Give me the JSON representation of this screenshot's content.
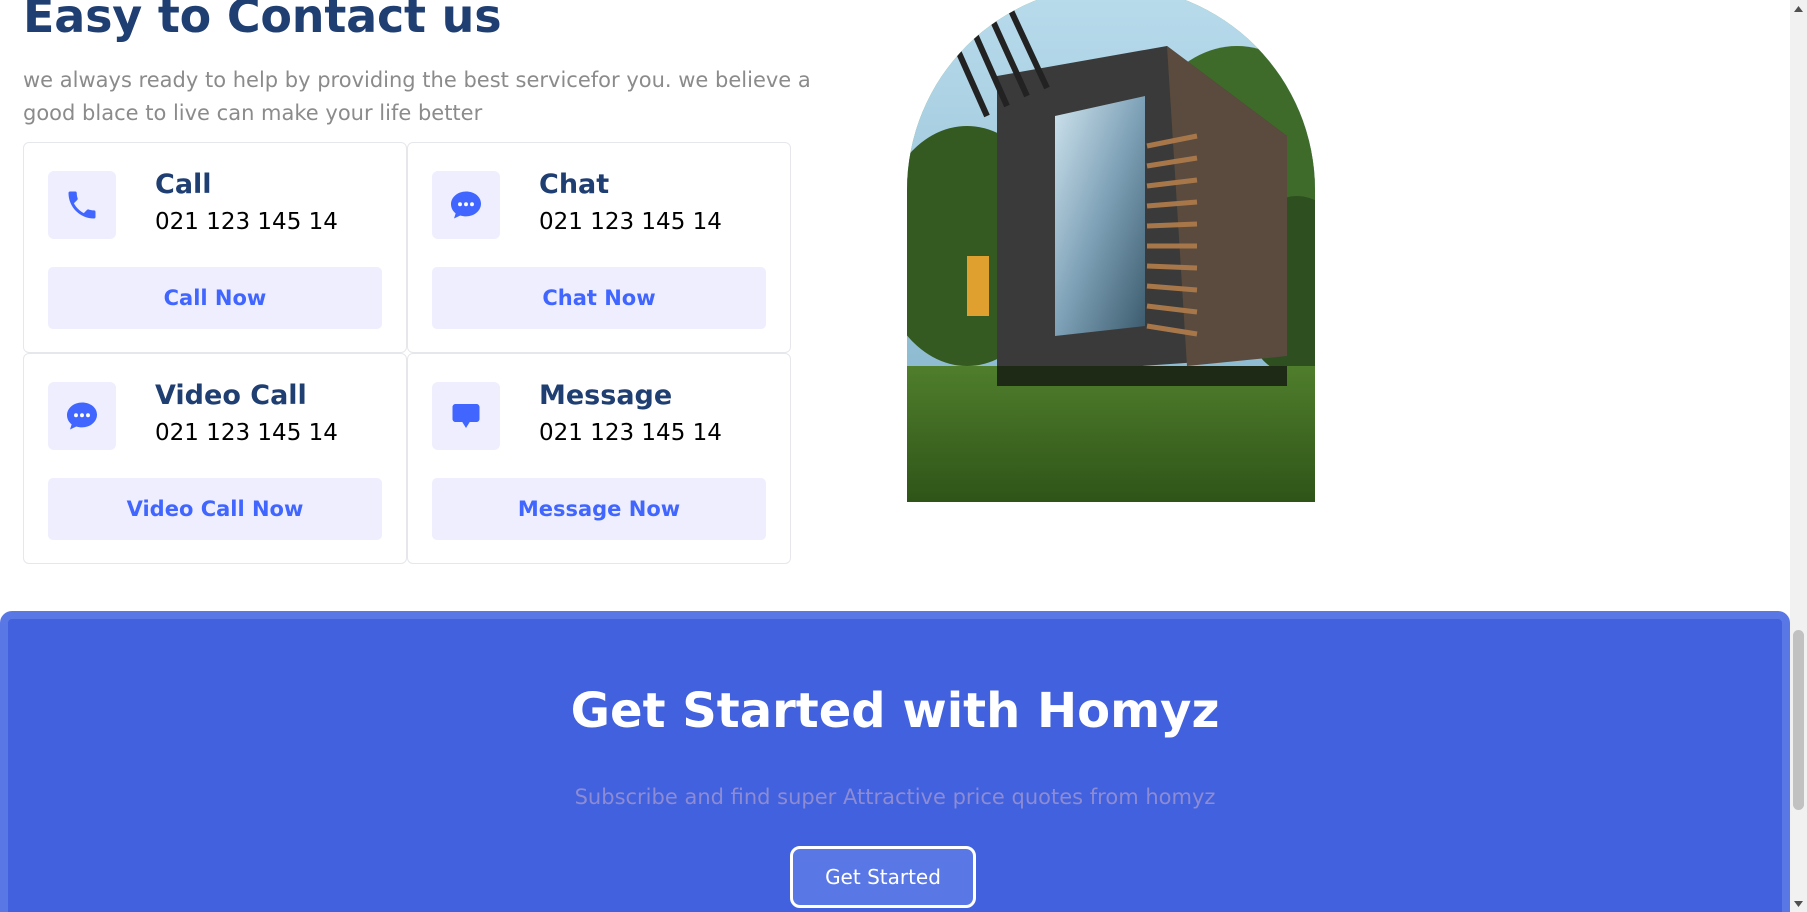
{
  "contact": {
    "title": "Easy to Contact us",
    "description": "we always ready to help by providing the best servicefor you. we believe a good blace to live can make your life better",
    "cards": [
      {
        "name": "Call",
        "phone": "021 123 145 14",
        "button": "Call Now",
        "icon": "phone-icon"
      },
      {
        "name": "Chat",
        "phone": "021 123 145 14",
        "button": "Chat Now",
        "icon": "chat-bubble-icon"
      },
      {
        "name": "Video Call",
        "phone": "021 123 145 14",
        "button": "Video Call Now",
        "icon": "video-chat-icon"
      },
      {
        "name": "Message",
        "phone": "021 123 145 14",
        "button": "Message Now",
        "icon": "message-icon"
      }
    ]
  },
  "get_started": {
    "title": "Get Started with Homyz",
    "subtitle": "Subscribe and find super Attractive price quotes from homyz",
    "button": "Get Started"
  },
  "colors": {
    "heading": "#1f3e72",
    "accent": "#4066ff",
    "soft_bg": "#eeeeff",
    "banner": "#4161df"
  }
}
